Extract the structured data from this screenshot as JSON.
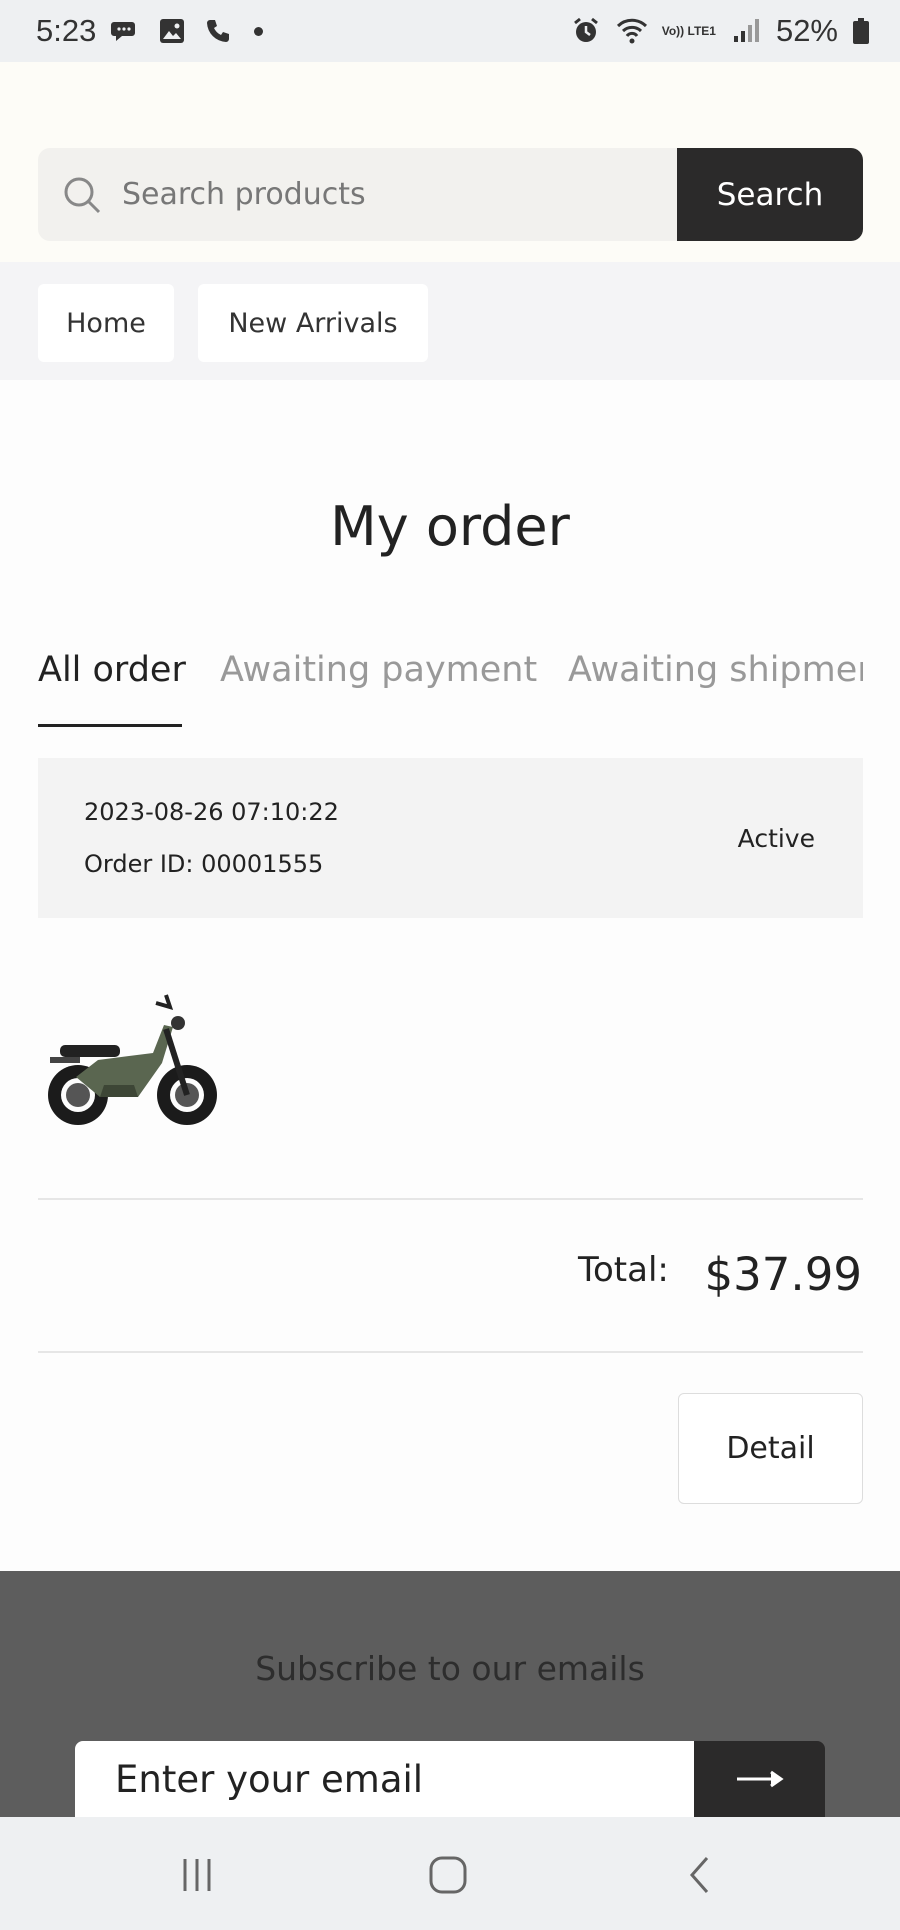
{
  "status_bar": {
    "time": "5:23",
    "battery": "52%",
    "network": "Vo)) LTE1",
    "icons": [
      "chat-icon",
      "gallery-icon",
      "phone-icon",
      "notification-dot",
      "alarm-icon",
      "wifi-icon",
      "signal-icon",
      "battery-icon"
    ]
  },
  "search": {
    "placeholder": "Search products",
    "button_label": "Search"
  },
  "nav": {
    "items": [
      {
        "label": "Home"
      },
      {
        "label": "New Arrivals"
      }
    ]
  },
  "page": {
    "title": "My order"
  },
  "tabs": [
    {
      "label": "All order",
      "active": true
    },
    {
      "label": "Awaiting payment",
      "active": false
    },
    {
      "label": "Awaiting shipment",
      "active": false
    }
  ],
  "order": {
    "date": "2023-08-26 07:10:22",
    "order_id": "Order ID: 00001555",
    "status": "Active",
    "product_image": "electric-moped-bike",
    "total_label": "Total:",
    "total_value": "$37.99",
    "detail_label": "Detail"
  },
  "footer": {
    "subscribe_title": "Subscribe to our emails",
    "email_placeholder": "Enter your email",
    "submit_icon": "arrow-right-icon"
  },
  "colors": {
    "accent_dark": "#2b2a2a",
    "footer_bg": "#5d5d5d",
    "muted_tab": "#999999"
  }
}
